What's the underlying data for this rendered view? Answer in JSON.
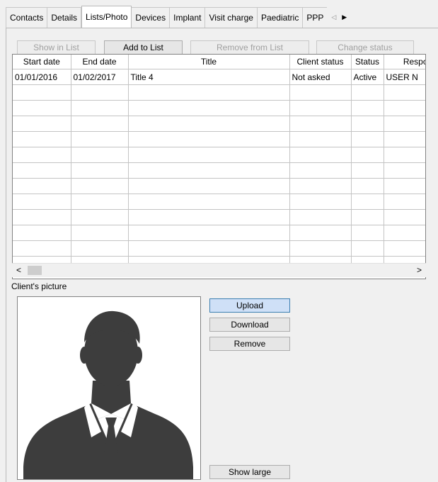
{
  "tabs": [
    {
      "label": "Contacts"
    },
    {
      "label": "Details"
    },
    {
      "label": "Lists/Photo",
      "active": true
    },
    {
      "label": "Devices"
    },
    {
      "label": "Implant"
    },
    {
      "label": "Visit charge"
    },
    {
      "label": "Paediatric"
    },
    {
      "label": "PPP"
    }
  ],
  "toolbar": {
    "show_in_list": "Show in List",
    "add_to_list": "Add to List",
    "remove_from_list": "Remove from List",
    "change_status": "Change status"
  },
  "grid": {
    "columns": [
      "Start date",
      "End date",
      "Title",
      "Client status",
      "Status",
      "Respo"
    ],
    "rows": [
      [
        "01/01/2016",
        "01/02/2017",
        "Title 4",
        "Not asked",
        "Active",
        "USER N"
      ]
    ]
  },
  "picture": {
    "label": "Client's picture",
    "upload": "Upload",
    "download": "Download",
    "remove": "Remove",
    "show_large": "Show large"
  },
  "colors": {
    "background": "#f0f0f0",
    "silhouette": "#3d3d3d",
    "focus_button": "#cfe0f7"
  },
  "icons": {
    "tab_scroll_left": "triangle-left-icon",
    "tab_scroll_right": "triangle-right-icon",
    "scroll_left": "chevron-left-icon",
    "scroll_right": "chevron-right-icon",
    "avatar": "person-silhouette-icon"
  }
}
